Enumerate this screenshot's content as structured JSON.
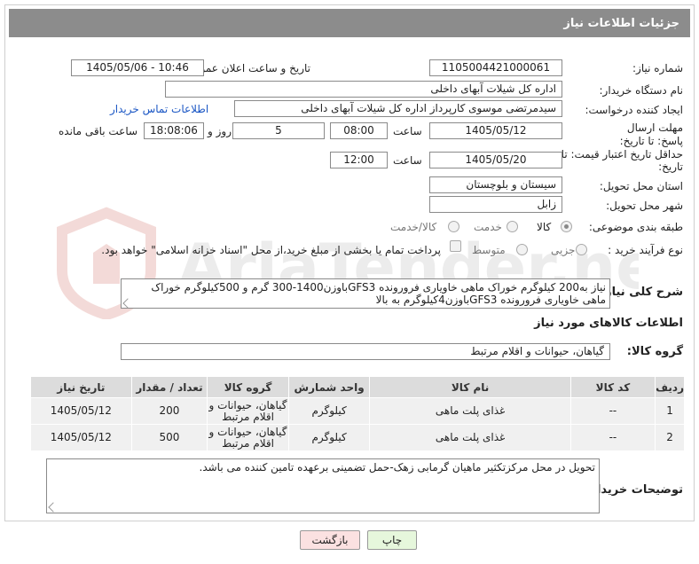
{
  "header": {
    "title": "جزئیات اطلاعات نیاز"
  },
  "fields": {
    "need_number": {
      "label": "شماره نیاز:",
      "value": "1105004421000061"
    },
    "announce_date": {
      "label": "تاریخ و ساعت اعلان عمومی:",
      "value": "1405/05/06 - 10:46"
    },
    "buyer_org": {
      "label": "نام دستگاه خریدار:",
      "value": "اداره کل شیلات آبهای داخلی"
    },
    "requester": {
      "label": "ایجاد کننده درخواست:",
      "value": "سیدمرتضی موسوی کارپرداز اداره کل شیلات آبهای داخلی",
      "contact_link": "اطلاعات تماس خریدار"
    },
    "deadline": {
      "label": "مهلت ارسال پاسخ: تا تاریخ:",
      "date": "1405/05/12",
      "time_label": "ساعت",
      "time": "08:00",
      "days": "5",
      "days_label": "روز و",
      "remaining": "18:08:06",
      "remaining_label": "ساعت باقی مانده"
    },
    "price_validity": {
      "label": "حداقل تاریخ اعتبار قیمت: تا تاریخ:",
      "date": "1405/05/20",
      "time_label": "ساعت",
      "time": "12:00"
    },
    "province": {
      "label": "استان محل تحویل:",
      "value": "سیستان و بلوچستان"
    },
    "city": {
      "label": "شهر محل تحویل:",
      "value": "زابل"
    },
    "category": {
      "label": "طبقه بندی موضوعی:",
      "options": [
        "کالا",
        "خدمت",
        "کالا/خدمت"
      ],
      "selected": "کالا"
    },
    "process": {
      "label": "نوع فرآیند خرید :",
      "options": [
        "جزیی",
        "متوسط"
      ],
      "selected": "",
      "payment_note": "پرداخت تمام یا بخشی از مبلغ خرید،از محل \"اسناد خزانه اسلامی\" خواهد بود."
    }
  },
  "description": {
    "label": "شرح کلی نیاز:",
    "value": "نیاز به200 کیلوگرم خوراک ماهی خاویاری فرورونده GFS3باوزن1400-300 گرم و 500کیلوگرم خوراک ماهی خاویاری فرورونده GFS3باوزن4کیلوگرم به بالا"
  },
  "goods_section": {
    "title": "اطلاعات کالاهای مورد نیاز",
    "group_label": "گروه کالا:",
    "group_value": "گیاهان، حیوانات و اقلام مرتبط"
  },
  "table": {
    "headers": [
      "ردیف",
      "کد کالا",
      "نام کالا",
      "واحد شمارش",
      "گروه کالا",
      "تعداد / مقدار",
      "تاریخ نیاز"
    ],
    "rows": [
      [
        "1",
        "--",
        "غذای پلت ماهی",
        "کیلوگرم",
        "گیاهان، حیوانات و اقلام مرتبط",
        "200",
        "1405/05/12"
      ],
      [
        "2",
        "--",
        "غذای پلت ماهی",
        "کیلوگرم",
        "گیاهان، حیوانات و اقلام مرتبط",
        "500",
        "1405/05/12"
      ]
    ]
  },
  "buyer_notes": {
    "label": "توضیحات خریدار:",
    "value": "تحویل در محل مرکزتکثیر ماهیان گرمابی زهک-حمل تضمینی برعهده تامین کننده می باشد."
  },
  "buttons": {
    "print": "چاپ",
    "back": "بازگشت"
  },
  "watermark": {
    "text": "AriaTender.neT"
  },
  "colors": {
    "titlebar": "#8c8c8c",
    "link": "#1a56c4",
    "print_btn": "#e6f7dc",
    "back_btn": "#fbe1e1",
    "table_header": "#dcdcdc"
  }
}
